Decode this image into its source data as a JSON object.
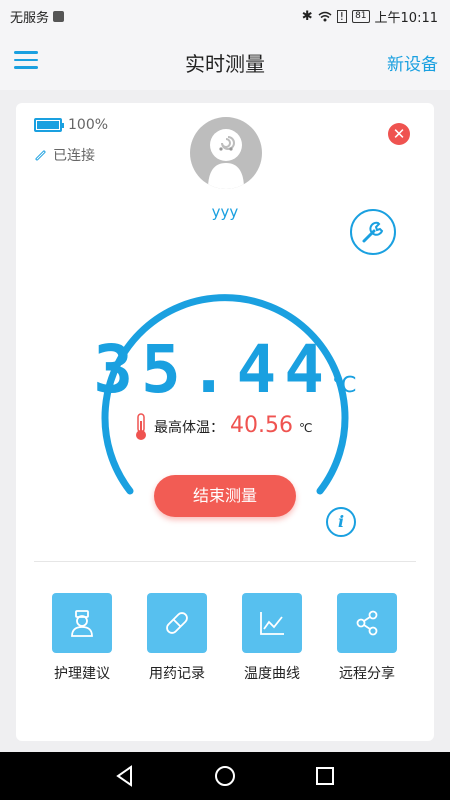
{
  "status_bar": {
    "carrier": "无服务",
    "battery": "81",
    "time": "上午10:11"
  },
  "header": {
    "title": "实时测量",
    "right_action": "新设备"
  },
  "device": {
    "battery_percent": "100%",
    "connection": "已连接",
    "username": "yyy"
  },
  "measurement": {
    "current_temp": "35.44",
    "unit": "℃",
    "max_label": "最高体温：",
    "max_temp": "40.56",
    "max_unit": "℃",
    "stop_label": "结束测量"
  },
  "actions": [
    {
      "label": "护理建议",
      "icon": "nurse-icon"
    },
    {
      "label": "用药记录",
      "icon": "pill-icon"
    },
    {
      "label": "温度曲线",
      "icon": "chart-icon"
    },
    {
      "label": "远程分享",
      "icon": "share-icon"
    }
  ],
  "colors": {
    "accent": "#1aa0e0",
    "danger": "#ef5350",
    "tile": "#57c0ef"
  }
}
